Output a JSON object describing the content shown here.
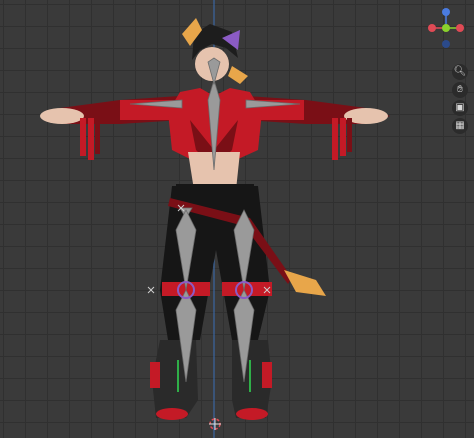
{
  "viewport": {
    "view": "front-orthographic",
    "background": "#3a3a3a",
    "grid_color": "#303030",
    "axis_z_color": "#3b6fb5"
  },
  "gizmo": {
    "axes": [
      {
        "name": "Z",
        "color": "#4a7be0"
      },
      {
        "name": "X",
        "color": "#e04a55"
      },
      {
        "name": "Y",
        "color": "#8ad02c"
      }
    ]
  },
  "navigation": {
    "buttons": [
      {
        "name": "zoom",
        "icon": "magnifier-icon"
      },
      {
        "name": "pan",
        "icon": "hand-icon"
      },
      {
        "name": "camera",
        "icon": "camera-icon"
      },
      {
        "name": "toggle-projection",
        "icon": "grid-icon"
      }
    ]
  },
  "character": {
    "palette": {
      "red": "#c41a26",
      "dark_red": "#7a0f16",
      "black": "#161616",
      "gray_bone": "#9a9a9a",
      "skin": "#e6c3ae",
      "gold": "#e8a64a",
      "purple": "#8b5bc5"
    }
  }
}
